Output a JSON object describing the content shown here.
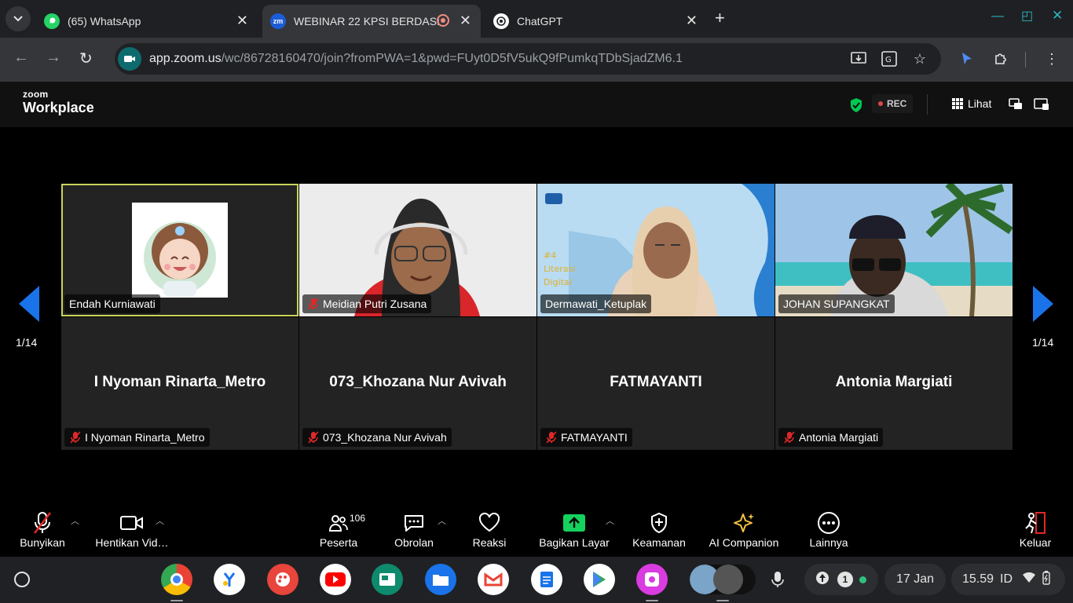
{
  "browser": {
    "tabs": [
      {
        "title": "(65) WhatsApp"
      },
      {
        "title": "WEBINAR 22 KPSI BERDASI"
      },
      {
        "title": "ChatGPT"
      }
    ],
    "url_host": "app.zoom.us",
    "url_path": "/wc/86728160470/join?fromPWA=1&pwd=FUyt0D5fV5ukQ9fPumkqTDbSjadZM6.1"
  },
  "zoom": {
    "logo_top": "zoom",
    "logo_bottom": "Workplace",
    "rec_label": "REC",
    "view_label": "Lihat",
    "page_indicator_left": "1/14",
    "page_indicator_right": "1/14",
    "tiles": [
      {
        "label": "Endah Kurniawati",
        "big": ""
      },
      {
        "label": "Meidian Putri Zusana",
        "big": ""
      },
      {
        "label": "Dermawati_Ketuplak",
        "big": ""
      },
      {
        "label": "JOHAN SUPANGKAT",
        "big": ""
      },
      {
        "label": "I Nyoman Rinarta_Metro",
        "big": "I Nyoman Rinarta_Metro"
      },
      {
        "label": "073_Khozana Nur Avivah",
        "big": "073_Khozana Nur Avivah"
      },
      {
        "label": "FATMAYANTI",
        "big": "FATMAYANTI"
      },
      {
        "label": "Antonia Margiati",
        "big": "Antonia Margiati"
      }
    ],
    "toolbar": {
      "unmute": "Bunyikan",
      "stop_video": "Hentikan Vid…",
      "participants": "Peserta",
      "participants_count": "106",
      "chat": "Obrolan",
      "reactions": "Reaksi",
      "share": "Bagikan Layar",
      "security": "Keamanan",
      "ai": "AI Companion",
      "more": "Lainnya",
      "leave": "Keluar"
    }
  },
  "shelf": {
    "notif_count": "1",
    "date": "17 Jan",
    "time": "15.59",
    "locale": "ID"
  },
  "colors": {
    "accent_green": "#00c853",
    "rec_dot": "#e0474c",
    "zoom_blue": "#0b5cff",
    "arrow_blue": "#1a73e8"
  }
}
